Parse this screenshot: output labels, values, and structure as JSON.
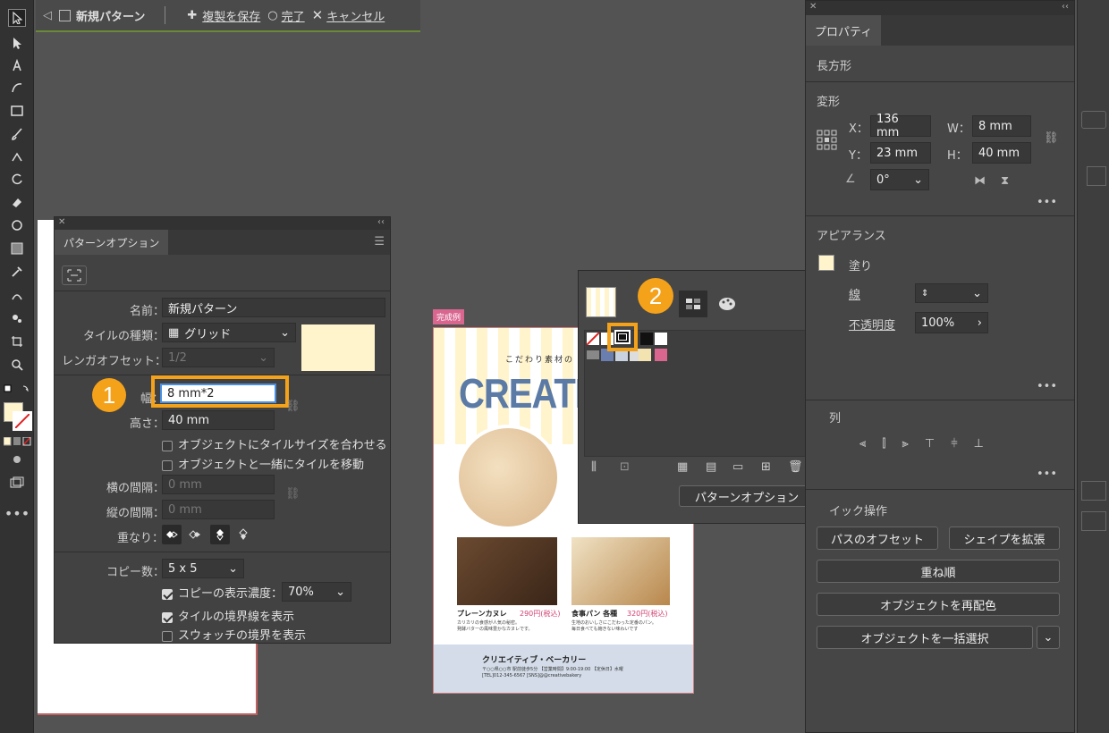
{
  "isolation": {
    "title": "新規パターン",
    "save_copy": "複製を保存",
    "done": "完了",
    "cancel": "キャンセル"
  },
  "pattern_options": {
    "tab": "パターンオプション",
    "name_label": "名前：",
    "name_value": "新規パターン",
    "tile_type_label": "タイルの種類：",
    "tile_type_value": "グリッド",
    "brick_offset_label": "レンガオフセット：",
    "brick_offset_value": "1/2",
    "width_label": "幅：",
    "width_value": "8 mm*2",
    "height_label": "高さ：",
    "height_value": "40 mm",
    "fit_tile": "オブジェクトにタイルサイズを合わせる",
    "move_tile": "オブジェクトと一緒にタイルを移動",
    "h_spacing_label": "横の間隔：",
    "h_spacing_value": "0 mm",
    "v_spacing_label": "縦の間隔：",
    "v_spacing_value": "0 mm",
    "overlap_label": "重なり：",
    "copies_label": "コピー数：",
    "copies_value": "5 x 5",
    "dim_copies": "コピーの表示濃度：",
    "dim_value": "70%",
    "show_tile_edge": "タイルの境界線を表示",
    "show_swatch_bounds": "スウォッチの境界を表示"
  },
  "swatch_popup": {
    "button": "パターンオプション"
  },
  "callouts": {
    "one": "1",
    "two": "2"
  },
  "flyer": {
    "tag": "完成例",
    "tagline": "こだわり素材の",
    "title": "CREATIVE",
    "item1_name": "プレーンカヌレ",
    "item1_price": "290円(税込)",
    "item1_desc1": "カリカリの食感が人気の秘密。",
    "item1_desc2": "発酵バターの風味豊かなカヌレです。",
    "item2_name": "食事パン 各種",
    "item2_price": "320円(税込)",
    "item2_desc1": "生地のおいしさにこだわった定番のパン。",
    "item2_desc2": "毎日食べても飽きない味わいです",
    "footer_name": "クリエイティブ・ベーカリー",
    "footer_line1": "〒○○県○○市 駅前徒歩5分 【営業時間】9:00-19:00 【定休日】水曜",
    "footer_line2": "[TEL]012-345-6567 [SNS]@@creativebakery"
  },
  "properties": {
    "tab": "プロパティ",
    "object_type": "長方形",
    "transform": "変形",
    "x_label": "X：",
    "x_value": "136 mm",
    "y_label": "Y：",
    "y_value": "23 mm",
    "w_label": "W：",
    "w_value": "8 mm",
    "h_label": "H：",
    "h_value": "40 mm",
    "angle_value": "0°",
    "appearance": "アピアランス",
    "fill": "塗り",
    "stroke": "線",
    "opacity": "不透明度",
    "opacity_value": "100%",
    "align_partial": "列",
    "quick_partial": "イック操作",
    "btn_offset": "パスのオフセット",
    "btn_expand": "シェイプを拡張",
    "btn_arrange": "重ね順",
    "btn_recolor": "オブジェクトを再配色",
    "btn_select_same": "オブジェクトを一括選択"
  },
  "colors": {
    "accent": "#f5a21b",
    "fill": "#fff4cc",
    "panel": "#424242"
  }
}
